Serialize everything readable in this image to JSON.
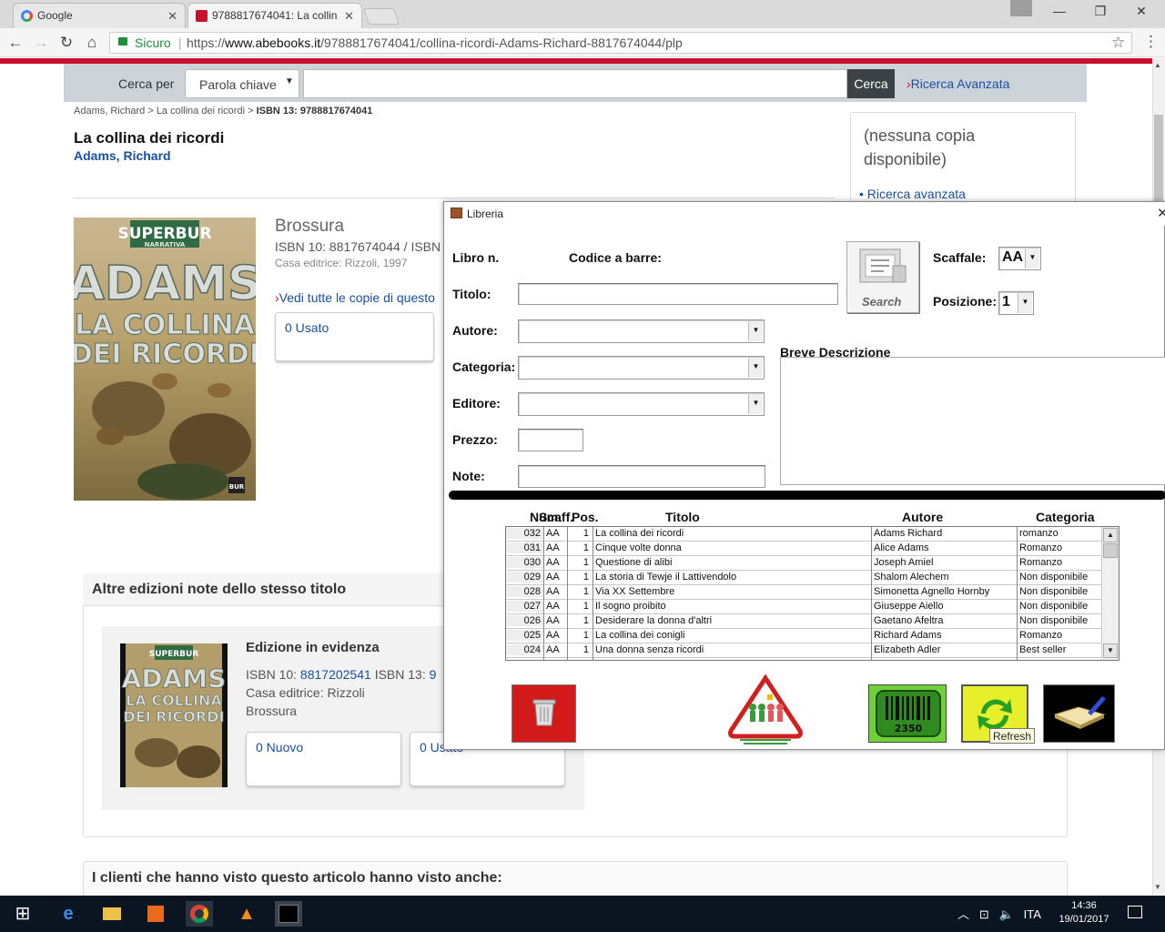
{
  "browser": {
    "tabs": [
      {
        "title": "Google"
      },
      {
        "title": "9788817674041: La collin"
      }
    ],
    "secure_label": "Sicuro",
    "url_prefix": "https://",
    "url_host": "www.abebooks.it",
    "url_path": "/9788817674041/collina-ricordi-Adams-Richard-8817674044/plp"
  },
  "site": {
    "search": {
      "label": "Cerca per",
      "select_value": "Parola chiave",
      "button": "Cerca",
      "advanced": "Ricerca Avanzata"
    },
    "breadcrumb": {
      "author": "Adams, Richard",
      "title": "La collina dei ricordi",
      "isbn": "ISBN 13: 9788817674041"
    },
    "book": {
      "title": "La collina dei ricordi",
      "author": "Adams, Richard",
      "binding": "Brossura",
      "isbn10_line": "ISBN 10: 8817674044 / ISBN",
      "publisher": "Casa editrice: Rizzoli, 1997",
      "see_all": "Vedi tutte le copie di questo",
      "used_count": "0 Usato",
      "cover": {
        "imprint": "SUPERBUR",
        "series": "NARRATIVA",
        "author": "ADAMS",
        "title_line1": "LA COLLINA",
        "title_line2": "DEI RICORDI",
        "logo": "BUR"
      }
    },
    "sidebar": {
      "text": "(nessuna copia disponibile)",
      "link": "Ricerca avanzata"
    },
    "editions": {
      "heading": "Altre edizioni note dello stesso titolo",
      "featured_label": "Edizione in evidenza",
      "isbn10_label": "ISBN 10:",
      "isbn10": "8817202541",
      "isbn13_label": "ISBN 13:",
      "isbn13_partial": "9",
      "publisher": "Casa editrice: Rizzoli",
      "binding": "Brossura",
      "new_count": "0 Nuovo",
      "used_count": "0 Usato"
    },
    "also_viewed": "I clienti che hanno visto questo articolo hanno visto anche:"
  },
  "libreria": {
    "title": "Libreria",
    "labels": {
      "libro": "Libro n.",
      "codice": "Codice a  barre:",
      "titolo": "Titolo:",
      "autore": "Autore:",
      "categoria": "Categoria:",
      "editore": "Editore:",
      "prezzo": "Prezzo:",
      "note": "Note:",
      "scaffale": "Scaffale:",
      "posizione": "Posizione:",
      "descrizione": "Breve Descrizione",
      "search": "Search"
    },
    "scaffale_value": "AA",
    "posizione_value": "1",
    "columns": [
      "Num.",
      "Scaff.",
      "Pos.",
      "Titolo",
      "Autore",
      "Categoria"
    ],
    "rows": [
      {
        "num": "032",
        "scaff": "AA",
        "pos": "1",
        "titolo": "La collina dei ricordi",
        "autore": "Adams Richard",
        "categoria": "romanzo"
      },
      {
        "num": "031",
        "scaff": "AA",
        "pos": "1",
        "titolo": "Cinque volte donna",
        "autore": "Alice Adams",
        "categoria": "Romanzo"
      },
      {
        "num": "030",
        "scaff": "AA",
        "pos": "1",
        "titolo": "Questione di alibi",
        "autore": "Joseph Amiel",
        "categoria": "Romanzo"
      },
      {
        "num": "029",
        "scaff": "AA",
        "pos": "1",
        "titolo": "La storia di Tewje il Lattivendolo",
        "autore": "Shalom Alechem",
        "categoria": "Non disponibile"
      },
      {
        "num": "028",
        "scaff": "AA",
        "pos": "1",
        "titolo": "Via XX Settembre",
        "autore": "Simonetta Agnello Hornby",
        "categoria": "Non disponibile"
      },
      {
        "num": "027",
        "scaff": "AA",
        "pos": "1",
        "titolo": "Il sogno proibito",
        "autore": "Giuseppe Aiello",
        "categoria": "Non disponibile"
      },
      {
        "num": "026",
        "scaff": "AA",
        "pos": "1",
        "titolo": "Desiderare la donna d'altri",
        "autore": "Gaetano Afeltra",
        "categoria": "Non disponibile"
      },
      {
        "num": "025",
        "scaff": "AA",
        "pos": "1",
        "titolo": "La collina dei conigli",
        "autore": "Richard Adams",
        "categoria": "Romanzo"
      },
      {
        "num": "024",
        "scaff": "AA",
        "pos": "1",
        "titolo": "Una donna senza ricordi",
        "autore": "Elizabeth Adler",
        "categoria": "Best seller"
      }
    ],
    "barcode_number": "2350",
    "refresh_tooltip": "Refresh"
  },
  "taskbar": {
    "language": "ITA",
    "time": "14:36",
    "date": "19/01/2017"
  }
}
